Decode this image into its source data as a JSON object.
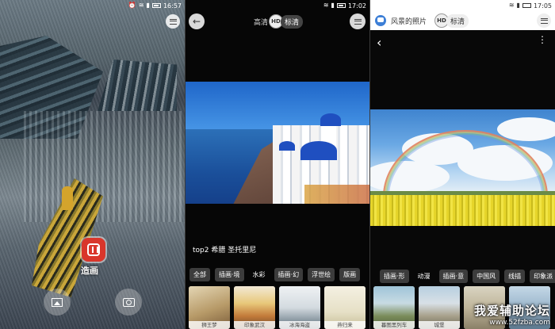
{
  "panel1": {
    "status": {
      "time": "16:57"
    },
    "logo_text": "造画"
  },
  "panel2": {
    "status": {
      "time": "17:02"
    },
    "quality": {
      "hd_label": "高清",
      "hd_badge": "HD",
      "standard_label": "标清"
    },
    "caption": "top2 希腊 圣托里尼",
    "categories": [
      "全部",
      "插画·境",
      "水彩",
      "插画·幻",
      "浮世绘",
      "版画"
    ],
    "active_category": "水彩",
    "thumbnails": [
      {
        "label": "狮王梦"
      },
      {
        "label": "印象武汉"
      },
      {
        "label": "冰海海盗"
      },
      {
        "label": "燕归来"
      }
    ]
  },
  "panel3": {
    "status": {
      "time": "17:05"
    },
    "app_title": "风景的照片",
    "quality": {
      "hd_badge": "HD",
      "standard_label": "标清"
    },
    "categories": [
      "插画·形",
      "动漫",
      "插画·意",
      "中国风",
      "线描",
      "印象派"
    ],
    "active_category": "动漫",
    "thumbnails": [
      {
        "label": "暮图黑列车"
      },
      {
        "label": "城堡"
      },
      {
        "label": ""
      },
      {
        "label": ""
      }
    ]
  },
  "watermark": {
    "title": "我爱辅助论坛",
    "url": "www.52fzba.com"
  }
}
